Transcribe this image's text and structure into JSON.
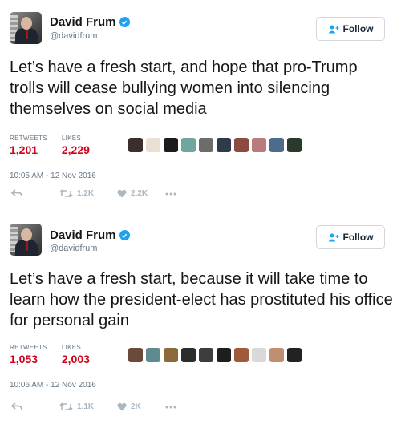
{
  "tweets": [
    {
      "name": "David Frum",
      "handle": "@davidfrum",
      "follow_label": "Follow",
      "text": "Let’s have a fresh start, and hope that pro-Trump trolls will cease bullying women into silencing themselves on social media",
      "retweets_label": "RETWEETS",
      "retweets": "1,201",
      "likes_label": "LIKES",
      "likes": "2,229",
      "timestamp": "10:05 AM - 12 Nov 2016",
      "retweet_count": "1.2K",
      "like_count": "2.2K",
      "liker_colors": [
        "#3a2f2a",
        "#e9dfd2",
        "#1c1c1c",
        "#6fa7a0",
        "#6c6c6c",
        "#2f3a4a",
        "#8c4b3e",
        "#b97b7b",
        "#4d6b8a",
        "#2a3a2a"
      ]
    },
    {
      "name": "David Frum",
      "handle": "@davidfrum",
      "follow_label": "Follow",
      "text": "Let’s have a fresh start, because it will take time to learn how the president-elect has prostituted his office for  personal gain",
      "retweets_label": "RETWEETS",
      "retweets": "1,053",
      "likes_label": "LIKES",
      "likes": "2,003",
      "timestamp": "10:06 AM - 12 Nov 2016",
      "retweet_count": "1.1K",
      "like_count": "2K",
      "liker_colors": [
        "#6b4a3a",
        "#5f8a8f",
        "#8a6a3a",
        "#2c2c2c",
        "#3d3d3d",
        "#1e1e1e",
        "#a05a3a",
        "#d9d9d9",
        "#c08f6f",
        "#222222"
      ]
    }
  ],
  "colors": {
    "accent": "#1da1f2",
    "count": "#d0021b",
    "muted": "#657786",
    "icon": "#aab8c2"
  },
  "icons": {
    "verified": "verified-badge-icon",
    "follow": "add-user-icon",
    "reply": "reply-icon",
    "retweet": "retweet-icon",
    "like": "heart-icon",
    "more": "more-icon"
  }
}
